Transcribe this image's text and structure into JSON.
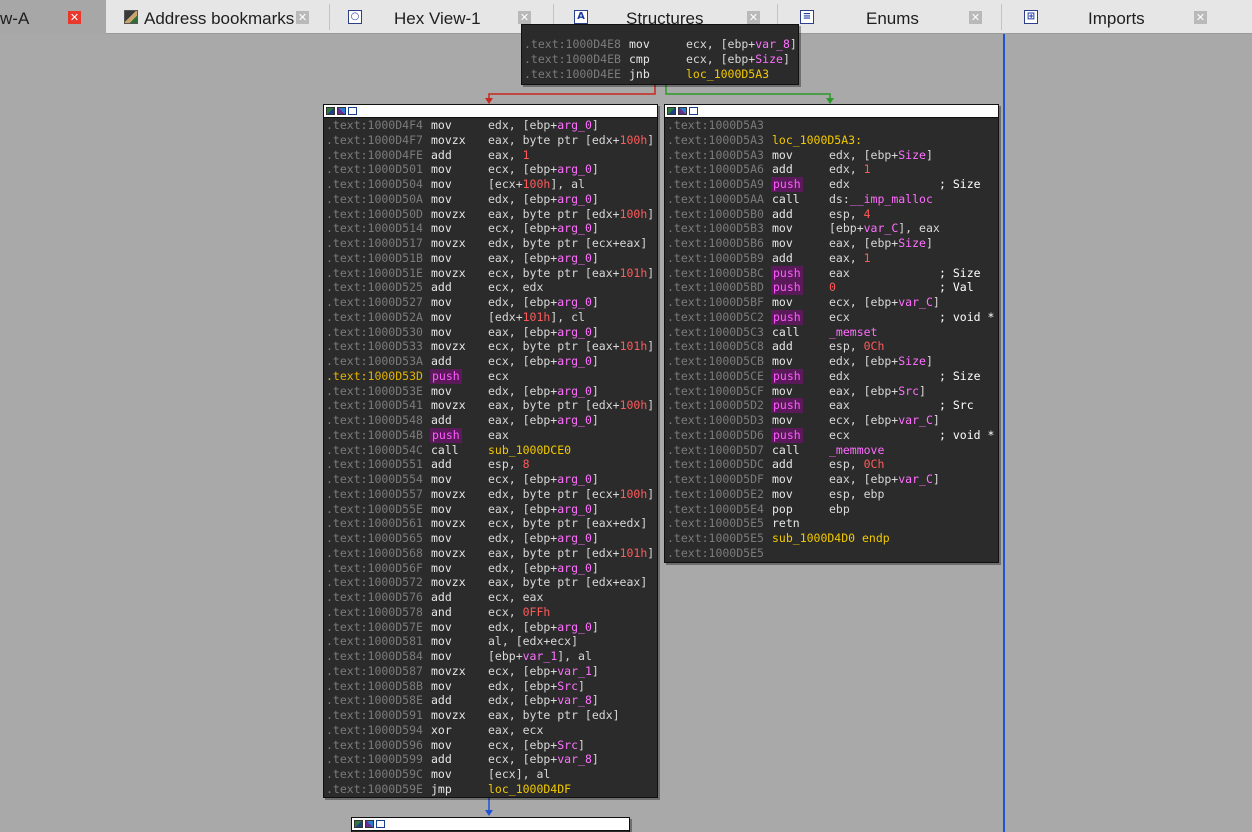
{
  "tabs": [
    {
      "label": "w-A",
      "icon": "",
      "active": true
    },
    {
      "label": "Address bookmarks",
      "icon": "bookmarks-icon"
    },
    {
      "label": "Hex View-1",
      "icon": "hex-view-icon"
    },
    {
      "label": "Structures",
      "icon": "structures-icon"
    },
    {
      "label": "Enums",
      "icon": "enums-icon"
    },
    {
      "label": "Imports",
      "icon": "imports-icon"
    }
  ],
  "top_node": [
    {
      "addr": ".text:1000D4E8",
      "mn": "mov",
      "op": [
        "ecx, [ebp+",
        {
          "v": "var_8"
        },
        "]"
      ]
    },
    {
      "addr": ".text:1000D4EB",
      "mn": "cmp",
      "op": [
        "ecx, [ebp+",
        {
          "v": "Size"
        },
        "]"
      ]
    },
    {
      "addr": ".text:1000D4EE",
      "mn": "jnb",
      "op": [
        {
          "l": "loc_1000D5A3"
        }
      ]
    }
  ],
  "left_node": [
    {
      "addr": ".text:1000D4F4",
      "mn": "mov",
      "op": [
        "edx, [ebp+",
        {
          "v": "arg_0"
        },
        "]"
      ]
    },
    {
      "addr": ".text:1000D4F7",
      "mn": "movzx",
      "op": [
        "eax, byte ptr [edx+",
        {
          "n": "100h"
        },
        "]"
      ]
    },
    {
      "addr": ".text:1000D4FE",
      "mn": "add",
      "op": [
        "eax, ",
        {
          "n": "1"
        }
      ]
    },
    {
      "addr": ".text:1000D501",
      "mn": "mov",
      "op": [
        "ecx, [ebp+",
        {
          "v": "arg_0"
        },
        "]"
      ]
    },
    {
      "addr": ".text:1000D504",
      "mn": "mov",
      "op": [
        "[ecx+",
        {
          "n": "100h"
        },
        "], al"
      ]
    },
    {
      "addr": ".text:1000D50A",
      "mn": "mov",
      "op": [
        "edx, [ebp+",
        {
          "v": "arg_0"
        },
        "]"
      ]
    },
    {
      "addr": ".text:1000D50D",
      "mn": "movzx",
      "op": [
        "eax, byte ptr [edx+",
        {
          "n": "100h"
        },
        "]"
      ]
    },
    {
      "addr": ".text:1000D514",
      "mn": "mov",
      "op": [
        "ecx, [ebp+",
        {
          "v": "arg_0"
        },
        "]"
      ]
    },
    {
      "addr": ".text:1000D517",
      "mn": "movzx",
      "op": [
        "edx, byte ptr [ecx+eax]"
      ]
    },
    {
      "addr": ".text:1000D51B",
      "mn": "mov",
      "op": [
        "eax, [ebp+",
        {
          "v": "arg_0"
        },
        "]"
      ]
    },
    {
      "addr": ".text:1000D51E",
      "mn": "movzx",
      "op": [
        "ecx, byte ptr [eax+",
        {
          "n": "101h"
        },
        "]"
      ]
    },
    {
      "addr": ".text:1000D525",
      "mn": "add",
      "op": [
        "ecx, edx"
      ]
    },
    {
      "addr": ".text:1000D527",
      "mn": "mov",
      "op": [
        "edx, [ebp+",
        {
          "v": "arg_0"
        },
        "]"
      ]
    },
    {
      "addr": ".text:1000D52A",
      "mn": "mov",
      "op": [
        "[edx+",
        {
          "n": "101h"
        },
        "], cl"
      ]
    },
    {
      "addr": ".text:1000D530",
      "mn": "mov",
      "op": [
        "eax, [ebp+",
        {
          "v": "arg_0"
        },
        "]"
      ]
    },
    {
      "addr": ".text:1000D533",
      "mn": "movzx",
      "op": [
        "ecx, byte ptr [eax+",
        {
          "n": "101h"
        },
        "]"
      ]
    },
    {
      "addr": ".text:1000D53A",
      "mn": "add",
      "op": [
        "ecx, [ebp+",
        {
          "v": "arg_0"
        },
        "]"
      ]
    },
    {
      "addr": ".text:1000D53D",
      "mn": "push",
      "op": [
        "ecx"
      ],
      "hl": true
    },
    {
      "addr": ".text:1000D53E",
      "mn": "mov",
      "op": [
        "edx, [ebp+",
        {
          "v": "arg_0"
        },
        "]"
      ]
    },
    {
      "addr": ".text:1000D541",
      "mn": "movzx",
      "op": [
        "eax, byte ptr [edx+",
        {
          "n": "100h"
        },
        "]"
      ]
    },
    {
      "addr": ".text:1000D548",
      "mn": "add",
      "op": [
        "eax, [ebp+",
        {
          "v": "arg_0"
        },
        "]"
      ]
    },
    {
      "addr": ".text:1000D54B",
      "mn": "push",
      "op": [
        "eax"
      ]
    },
    {
      "addr": ".text:1000D54C",
      "mn": "call",
      "op": [
        {
          "l": "sub_1000DCE0"
        }
      ]
    },
    {
      "addr": ".text:1000D551",
      "mn": "add",
      "op": [
        "esp, ",
        {
          "n": "8"
        }
      ]
    },
    {
      "addr": ".text:1000D554",
      "mn": "mov",
      "op": [
        "ecx, [ebp+",
        {
          "v": "arg_0"
        },
        "]"
      ]
    },
    {
      "addr": ".text:1000D557",
      "mn": "movzx",
      "op": [
        "edx, byte ptr [ecx+",
        {
          "n": "100h"
        },
        "]"
      ]
    },
    {
      "addr": ".text:1000D55E",
      "mn": "mov",
      "op": [
        "eax, [ebp+",
        {
          "v": "arg_0"
        },
        "]"
      ]
    },
    {
      "addr": ".text:1000D561",
      "mn": "movzx",
      "op": [
        "ecx, byte ptr [eax+edx]"
      ]
    },
    {
      "addr": ".text:1000D565",
      "mn": "mov",
      "op": [
        "edx, [ebp+",
        {
          "v": "arg_0"
        },
        "]"
      ]
    },
    {
      "addr": ".text:1000D568",
      "mn": "movzx",
      "op": [
        "eax, byte ptr [edx+",
        {
          "n": "101h"
        },
        "]"
      ]
    },
    {
      "addr": ".text:1000D56F",
      "mn": "mov",
      "op": [
        "edx, [ebp+",
        {
          "v": "arg_0"
        },
        "]"
      ]
    },
    {
      "addr": ".text:1000D572",
      "mn": "movzx",
      "op": [
        "eax, byte ptr [edx+eax]"
      ]
    },
    {
      "addr": ".text:1000D576",
      "mn": "add",
      "op": [
        "ecx, eax"
      ]
    },
    {
      "addr": ".text:1000D578",
      "mn": "and",
      "op": [
        "ecx, ",
        {
          "n": "0FFh"
        }
      ]
    },
    {
      "addr": ".text:1000D57E",
      "mn": "mov",
      "op": [
        "edx, [ebp+",
        {
          "v": "arg_0"
        },
        "]"
      ]
    },
    {
      "addr": ".text:1000D581",
      "mn": "mov",
      "op": [
        "al, [edx+ecx]"
      ]
    },
    {
      "addr": ".text:1000D584",
      "mn": "mov",
      "op": [
        "[ebp+",
        {
          "v": "var_1"
        },
        "], al"
      ]
    },
    {
      "addr": ".text:1000D587",
      "mn": "movzx",
      "op": [
        "ecx, [ebp+",
        {
          "v": "var_1"
        },
        "]"
      ]
    },
    {
      "addr": ".text:1000D58B",
      "mn": "mov",
      "op": [
        "edx, [ebp+",
        {
          "v": "Src"
        },
        "]"
      ]
    },
    {
      "addr": ".text:1000D58E",
      "mn": "add",
      "op": [
        "edx, [ebp+",
        {
          "v": "var_8"
        },
        "]"
      ]
    },
    {
      "addr": ".text:1000D591",
      "mn": "movzx",
      "op": [
        "eax, byte ptr [edx]"
      ]
    },
    {
      "addr": ".text:1000D594",
      "mn": "xor",
      "op": [
        "eax, ecx"
      ]
    },
    {
      "addr": ".text:1000D596",
      "mn": "mov",
      "op": [
        "ecx, [ebp+",
        {
          "v": "Src"
        },
        "]"
      ]
    },
    {
      "addr": ".text:1000D599",
      "mn": "add",
      "op": [
        "ecx, [ebp+",
        {
          "v": "var_8"
        },
        "]"
      ]
    },
    {
      "addr": ".text:1000D59C",
      "mn": "mov",
      "op": [
        "[ecx], al"
      ]
    },
    {
      "addr": ".text:1000D59E",
      "mn": "jmp",
      "op": [
        {
          "l": "loc_1000D4DF"
        }
      ]
    }
  ],
  "right_node": [
    {
      "addr": ".text:1000D5A3",
      "mn": "",
      "op": []
    },
    {
      "addr": ".text:1000D5A3",
      "label": "loc_1000D5A3:"
    },
    {
      "addr": ".text:1000D5A3",
      "mn": "mov",
      "op": [
        "edx, [ebp+",
        {
          "v": "Size"
        },
        "]"
      ]
    },
    {
      "addr": ".text:1000D5A6",
      "mn": "add",
      "op": [
        "edx, ",
        {
          "n": "1"
        }
      ]
    },
    {
      "addr": ".text:1000D5A9",
      "mn": "push",
      "op": [
        "edx"
      ],
      "cm": "; Size"
    },
    {
      "addr": ".text:1000D5AA",
      "mn": "call",
      "op": [
        "ds:",
        {
          "f": "__imp_malloc"
        }
      ]
    },
    {
      "addr": ".text:1000D5B0",
      "mn": "add",
      "op": [
        "esp, ",
        {
          "n": "4"
        }
      ]
    },
    {
      "addr": ".text:1000D5B3",
      "mn": "mov",
      "op": [
        "[ebp+",
        {
          "v": "var_C"
        },
        "], eax"
      ]
    },
    {
      "addr": ".text:1000D5B6",
      "mn": "mov",
      "op": [
        "eax, [ebp+",
        {
          "v": "Size"
        },
        "]"
      ]
    },
    {
      "addr": ".text:1000D5B9",
      "mn": "add",
      "op": [
        "eax, ",
        {
          "n": "1"
        }
      ]
    },
    {
      "addr": ".text:1000D5BC",
      "mn": "push",
      "op": [
        "eax"
      ],
      "cm": "; Size"
    },
    {
      "addr": ".text:1000D5BD",
      "mn": "push",
      "op": [
        {
          "n": "0"
        }
      ],
      "cm": "; Val"
    },
    {
      "addr": ".text:1000D5BF",
      "mn": "mov",
      "op": [
        "ecx, [ebp+",
        {
          "v": "var_C"
        },
        "]"
      ]
    },
    {
      "addr": ".text:1000D5C2",
      "mn": "push",
      "op": [
        "ecx"
      ],
      "cm": "; void *"
    },
    {
      "addr": ".text:1000D5C3",
      "mn": "call",
      "op": [
        {
          "f": "_memset"
        }
      ]
    },
    {
      "addr": ".text:1000D5C8",
      "mn": "add",
      "op": [
        "esp, ",
        {
          "n": "0Ch"
        }
      ]
    },
    {
      "addr": ".text:1000D5CB",
      "mn": "mov",
      "op": [
        "edx, [ebp+",
        {
          "v": "Size"
        },
        "]"
      ]
    },
    {
      "addr": ".text:1000D5CE",
      "mn": "push",
      "op": [
        "edx"
      ],
      "cm": "; Size"
    },
    {
      "addr": ".text:1000D5CF",
      "mn": "mov",
      "op": [
        "eax, [ebp+",
        {
          "v": "Src"
        },
        "]"
      ]
    },
    {
      "addr": ".text:1000D5D2",
      "mn": "push",
      "op": [
        "eax"
      ],
      "cm": "; Src"
    },
    {
      "addr": ".text:1000D5D3",
      "mn": "mov",
      "op": [
        "ecx, [ebp+",
        {
          "v": "var_C"
        },
        "]"
      ]
    },
    {
      "addr": ".text:1000D5D6",
      "mn": "push",
      "op": [
        "ecx"
      ],
      "cm": "; void *"
    },
    {
      "addr": ".text:1000D5D7",
      "mn": "call",
      "op": [
        {
          "f": "_memmove"
        }
      ]
    },
    {
      "addr": ".text:1000D5DC",
      "mn": "add",
      "op": [
        "esp, ",
        {
          "n": "0Ch"
        }
      ]
    },
    {
      "addr": ".text:1000D5DF",
      "mn": "mov",
      "op": [
        "eax, [ebp+",
        {
          "v": "var_C"
        },
        "]"
      ]
    },
    {
      "addr": ".text:1000D5E2",
      "mn": "mov",
      "op": [
        "esp, ebp"
      ]
    },
    {
      "addr": ".text:1000D5E4",
      "mn": "pop",
      "op": [
        "ebp"
      ]
    },
    {
      "addr": ".text:1000D5E5",
      "mn": "retn",
      "op": []
    },
    {
      "addr": ".text:1000D5E5",
      "label": "sub_1000D4D0 endp"
    },
    {
      "addr": ".text:1000D5E5",
      "mn": "",
      "op": []
    }
  ],
  "colors": {
    "canvas": "#a9a9a9",
    "node_bg": "#2b2b2b",
    "address": "#7b7b7b",
    "highlighted_address": "#e2b300",
    "variable": "#ff70ff",
    "number": "#ff5a5a",
    "label": "#f2c900",
    "edge_false": "#c8281e",
    "edge_true": "#2a9a2a",
    "edge_flow": "#2052d4"
  }
}
